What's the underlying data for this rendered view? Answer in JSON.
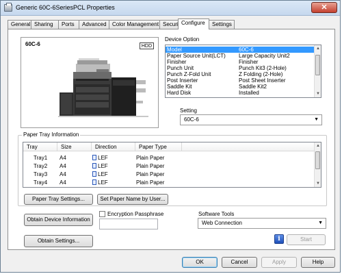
{
  "window": {
    "title": "Generic 60C-6SeriesPCL Properties",
    "close_symbol": "✕"
  },
  "tabs": [
    {
      "label": "General"
    },
    {
      "label": "Sharing"
    },
    {
      "label": "Ports"
    },
    {
      "label": "Advanced"
    },
    {
      "label": "Color Management"
    },
    {
      "label": "Security"
    },
    {
      "label": "Configure",
      "active": true
    },
    {
      "label": "Settings"
    }
  ],
  "preview": {
    "model": "60C-6",
    "badge": "HDD"
  },
  "device_option": {
    "label": "Device Option",
    "rows": [
      {
        "name": "Model",
        "value": "60C-6",
        "selected": true
      },
      {
        "name": "Paper Source Unit(LCT)",
        "value": "Large Capacity Unit2"
      },
      {
        "name": "Finisher",
        "value": "Finisher"
      },
      {
        "name": "Punch Unit",
        "value": "Punch Kit3 (2-Hole)"
      },
      {
        "name": "Punch Z-Fold Unit",
        "value": "Z Folding (2-Hole)"
      },
      {
        "name": "Post Inserter",
        "value": "Post Sheet Inserter"
      },
      {
        "name": "Saddle Kit",
        "value": "Saddle Kit2"
      },
      {
        "name": "Hard Disk",
        "value": "Installed"
      }
    ]
  },
  "setting": {
    "label": "Setting",
    "value": "60C-6"
  },
  "paper_tray": {
    "label": "Paper Tray Information",
    "columns": [
      "Tray",
      "Size",
      "Direction",
      "Paper Type"
    ],
    "rows": [
      {
        "tray": "Tray1",
        "size": "A4",
        "direction": "LEF",
        "type": "Plain Paper"
      },
      {
        "tray": "Tray2",
        "size": "A4",
        "direction": "LEF",
        "type": "Plain Paper"
      },
      {
        "tray": "Tray3",
        "size": "A4",
        "direction": "LEF",
        "type": "Plain Paper"
      },
      {
        "tray": "Tray4",
        "size": "A4",
        "direction": "LEF",
        "type": "Plain Paper"
      }
    ],
    "settings_button": "Paper Tray Settings...",
    "set_name_button": "Set Paper Name by User..."
  },
  "device_info": {
    "obtain_info_button": "Obtain Device Information",
    "obtain_settings_button": "Obtain Settings..."
  },
  "encryption": {
    "label": "Encryption Passphrase",
    "checked": false,
    "value": ""
  },
  "software_tools": {
    "label": "Software Tools",
    "value": "Web Connection",
    "info_icon": "i",
    "start_button": "Start"
  },
  "footer": {
    "ok": "OK",
    "cancel": "Cancel",
    "apply": "Apply",
    "help": "Help"
  }
}
